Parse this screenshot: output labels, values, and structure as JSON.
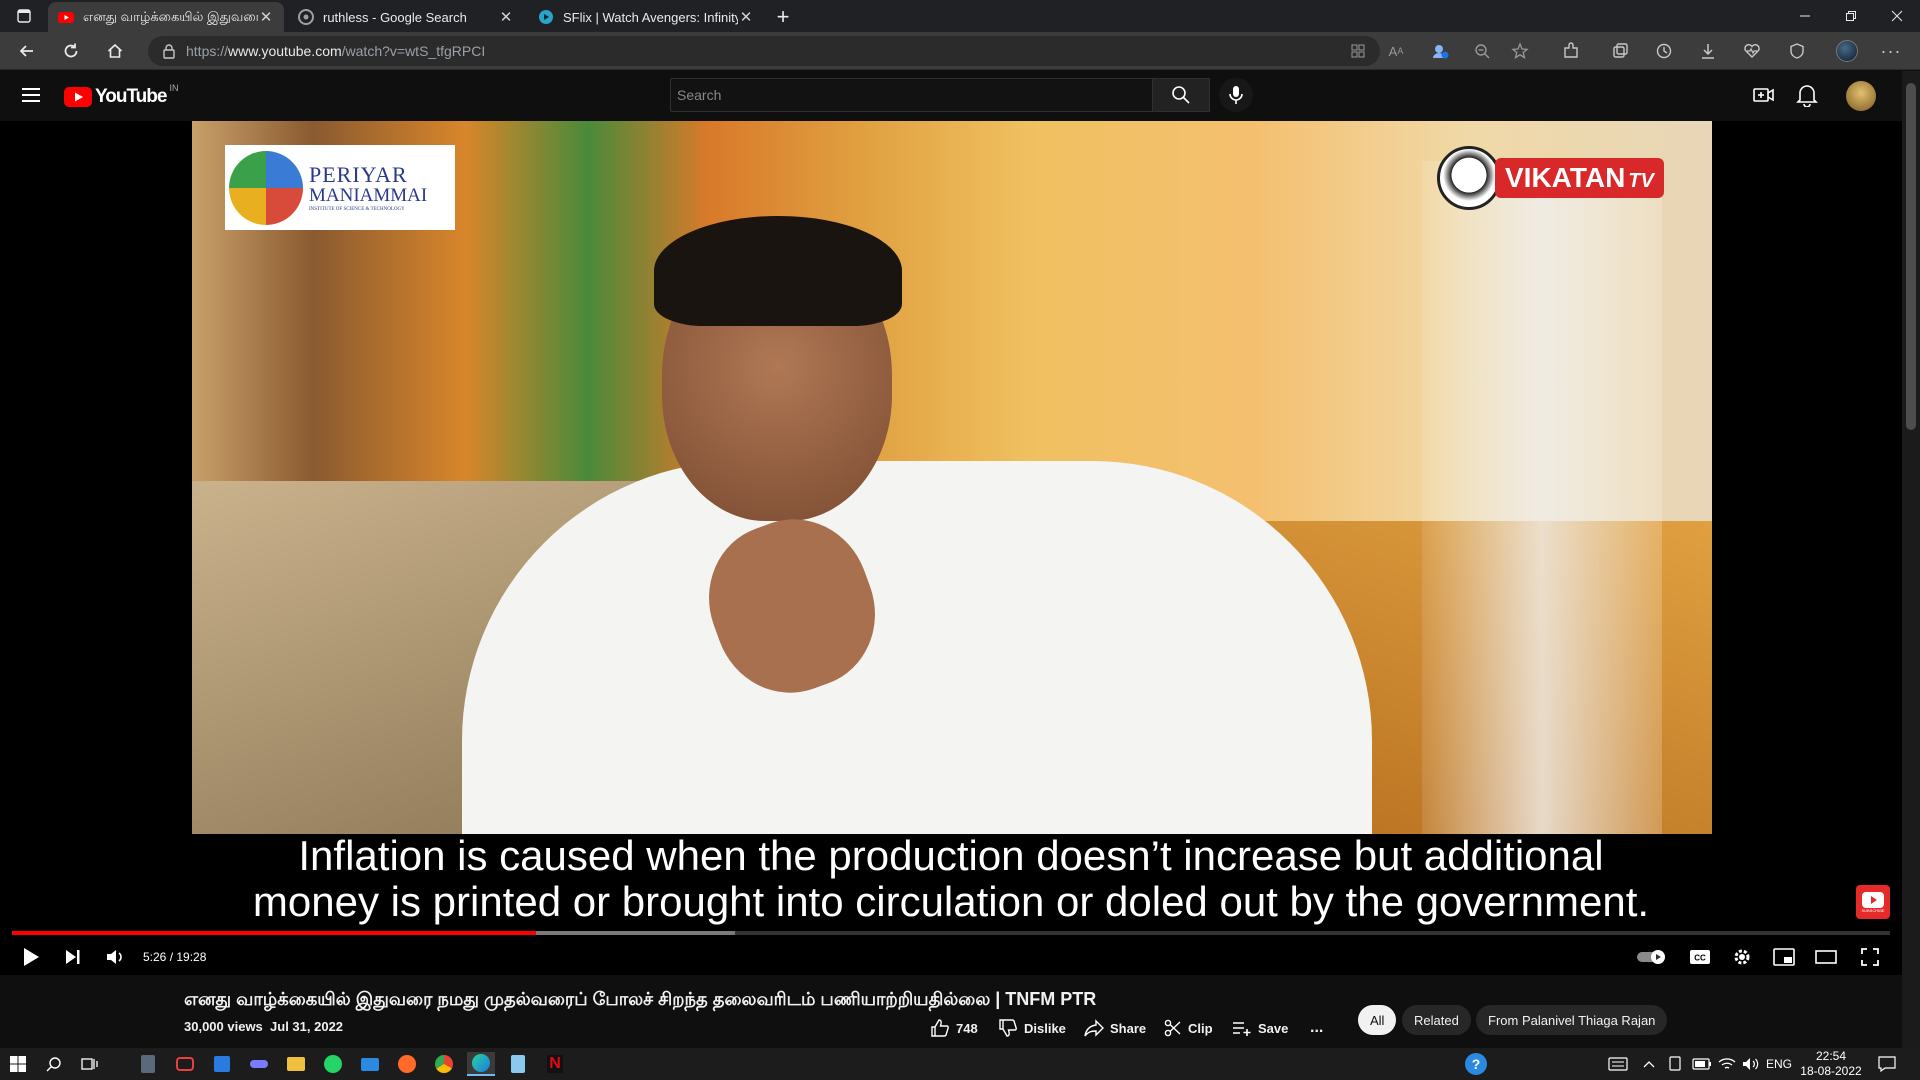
{
  "browser": {
    "tabs": [
      {
        "title": "எனது வாழ்க்கையில் இதுவரை",
        "favicon": "youtube-icon",
        "active": true
      },
      {
        "title": "ruthless - Google Search",
        "favicon": "google-icon",
        "active": false
      },
      {
        "title": "SFlix | Watch Avengers: Infinity W",
        "favicon": "sflix-icon",
        "active": false
      }
    ],
    "url_prefix": "https://",
    "url_host": "www.youtube.com",
    "url_path": "/watch?v=wtS_tfgRPCI",
    "accent": "#3c3c3c"
  },
  "youtube": {
    "logo_text": "YouTube",
    "region": "IN",
    "search_placeholder": "Search",
    "brand_red": "#ff0000"
  },
  "player": {
    "overlay_left_line1": "PERIYAR",
    "overlay_left_line2": "MANIAMMAI",
    "overlay_left_line3": "INSTITUTE OF SCIENCE & TECHNOLOGY",
    "overlay_right": "VIKATAN",
    "overlay_right_suffix": "TV",
    "caption_line1": "Inflation is caused when the production doesn’t increase but additional",
    "caption_line2": "money is printed or brought into circulation or doled out by the government.",
    "time": "5:26 / 19:28",
    "progress": 0.279,
    "subscribe_label": "SUBSCRIBE"
  },
  "video": {
    "title": "எனது வாழ்க்கையில் இதுவரை நமது முதல்வரைப் போலச் சிறந்த தலைவரிடம் பணியாற்றியதில்லை | TNFM PTR",
    "views": "30,000 views",
    "date": "Jul 31, 2022",
    "likes": "748",
    "dislike_label": "Dislike",
    "share_label": "Share",
    "clip_label": "Clip",
    "save_label": "Save",
    "more_label": "...",
    "chips": [
      "All",
      "Related",
      "From Palanivel Thiaga Rajan"
    ]
  },
  "taskbar": {
    "language": "ENG",
    "time": "22:54",
    "date": "18-08-2022"
  }
}
